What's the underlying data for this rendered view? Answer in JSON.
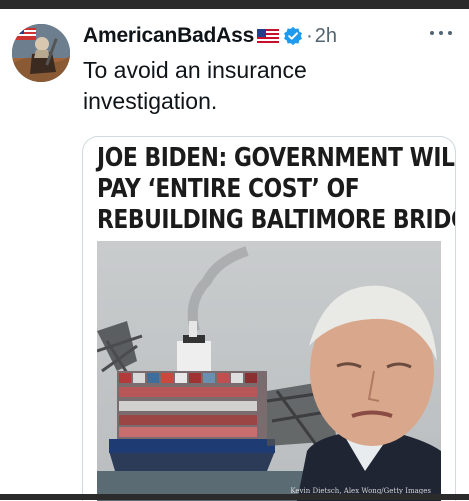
{
  "tweet": {
    "author_name": "AmericanBadAss",
    "timestamp": "2h",
    "separator": "·",
    "text": "To avoid an insurance investigation."
  },
  "card": {
    "headline_lines": [
      "JOE BIDEN: GOVERNMENT WILL",
      "PAY ‘ENTIRE COST’ OF",
      "REBUILDING BALTIMORE BRIDGE"
    ],
    "photo_credit": "Kevin Dietsch, Alex Wong/Getty Images"
  },
  "icons": {
    "avatar": "avatar-illustration",
    "flag": "us-flag-icon",
    "verified": "verified-badge-icon",
    "more": "more-options-icon"
  },
  "colors": {
    "verified_blue": "#1d9bf0",
    "text_primary": "#0f1419",
    "text_secondary": "#536471"
  }
}
